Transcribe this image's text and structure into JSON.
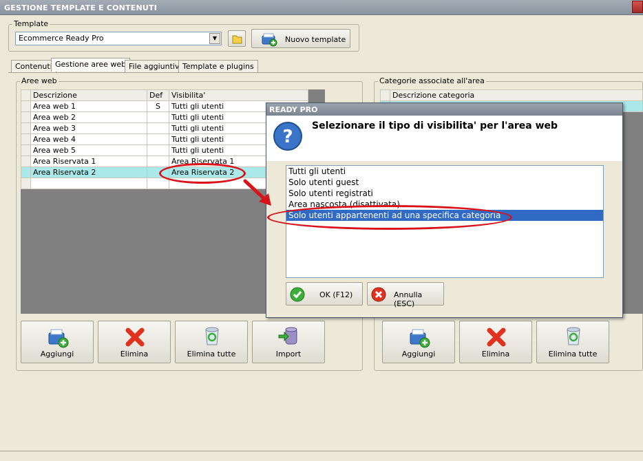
{
  "window": {
    "title": "GESTIONE TEMPLATE E CONTENUTI"
  },
  "template": {
    "group_label": "Template",
    "selected": "Ecommerce Ready Pro",
    "new_button": "Nuovo template"
  },
  "tabs": [
    "Contenuti",
    "Gestione aree web",
    "File aggiuntivi",
    "Template e plugins"
  ],
  "aree_web": {
    "group_label": "Aree web",
    "columns": [
      "Descrizione",
      "Def",
      "Visibilita'"
    ],
    "rows": [
      {
        "descr": "Area web 1",
        "def": "S",
        "vis": "Tutti gli utenti"
      },
      {
        "descr": "Area web 2",
        "def": "",
        "vis": "Tutti gli utenti"
      },
      {
        "descr": "Area web 3",
        "def": "",
        "vis": "Tutti gli utenti"
      },
      {
        "descr": "Area web 4",
        "def": "",
        "vis": "Tutti gli utenti"
      },
      {
        "descr": "Area web 5",
        "def": "",
        "vis": "Tutti gli utenti"
      },
      {
        "descr": "Area Riservata 1",
        "def": "",
        "vis": "Area Riservata 1"
      },
      {
        "descr": "Area Riservata 2",
        "def": "",
        "vis": "Area Riservata 2"
      }
    ],
    "buttons": {
      "add": "Aggiungi",
      "delete": "Elimina",
      "delete_all": "Elimina tutte",
      "import": "Import"
    }
  },
  "categorie": {
    "group_label": "Categorie associate all'area",
    "column": "Descrizione categoria",
    "buttons": {
      "add": "Aggiungi",
      "delete": "Elimina",
      "delete_all": "Elimina tutte"
    }
  },
  "dialog": {
    "title": "READY PRO",
    "message": "Selezionare il tipo di visibilita' per l'area web",
    "options": [
      "Tutti gli utenti",
      "Solo utenti guest",
      "Solo utenti registrati",
      "Area nascosta (disattivata)",
      "Solo utenti appartenenti ad una specifica categoria"
    ],
    "selected_index": 4,
    "ok": "OK (F12)",
    "cancel": "Annulla (ESC)"
  },
  "colors": {
    "selection": "#316ac5",
    "row_highlight": "#a9e9ea",
    "annotation": "#d8141a"
  }
}
